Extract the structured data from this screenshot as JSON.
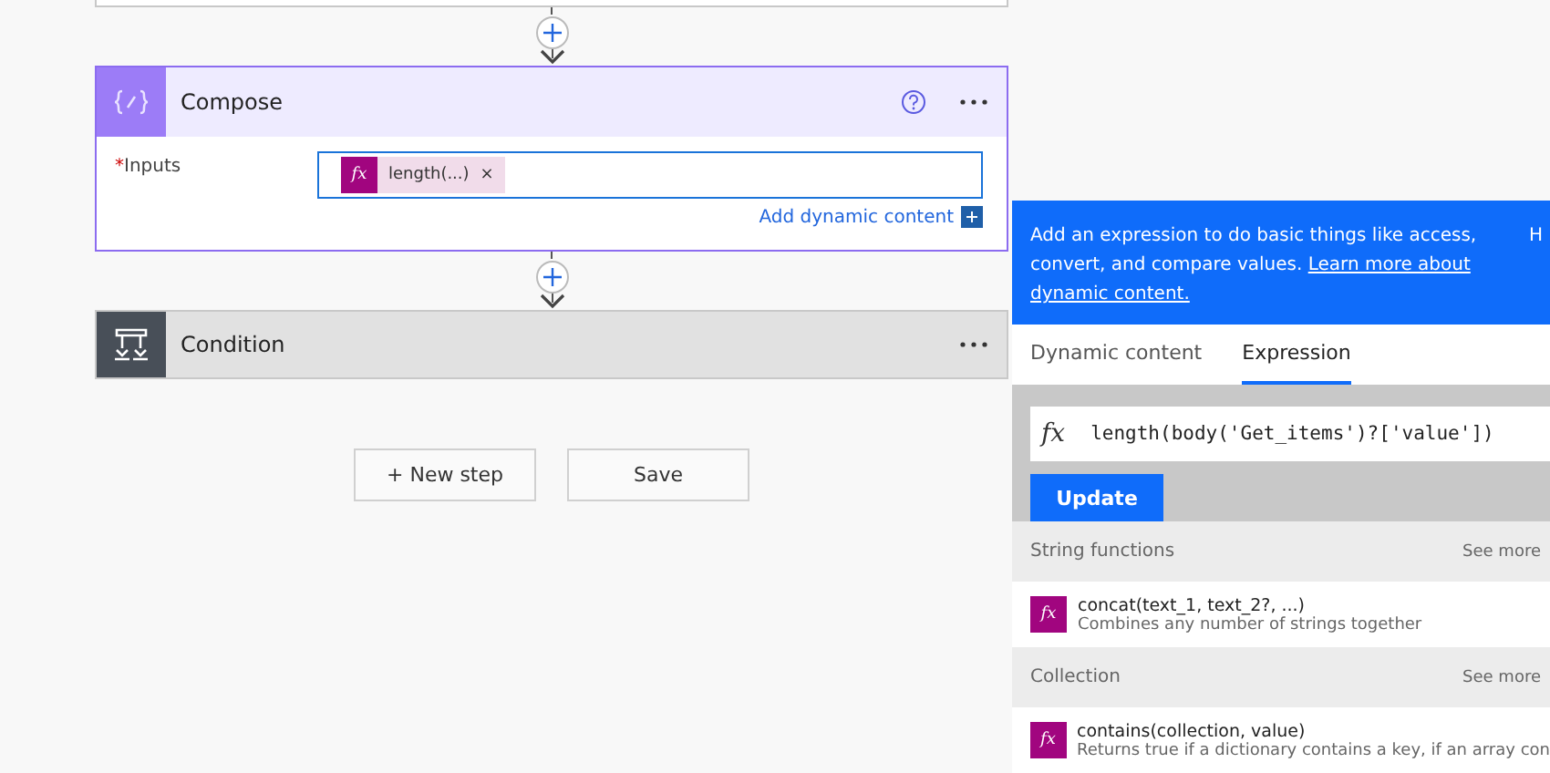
{
  "compose": {
    "title": "Compose",
    "field_label": "Inputs",
    "required_mark": "*",
    "token_icon": "fx",
    "token": "length(...)",
    "token_remove": "×",
    "add_dynamic": "Add dynamic content"
  },
  "condition": {
    "title": "Condition"
  },
  "buttons": [
    {
      "label": "+ New step"
    },
    {
      "label": "Save"
    }
  ],
  "panel": {
    "info": "Add an expression to do basic things like access, convert, and compare values. ",
    "info_link": [
      "Learn more about",
      "dynamic content."
    ],
    "info_cut": "H",
    "tabs": [
      {
        "label": "Dynamic content",
        "selected": false
      },
      {
        "label": "Expression",
        "selected": true
      }
    ],
    "expression_icon": "fx",
    "expression": "length(body('Get_items')?['value'])",
    "update": "Update",
    "groups": [
      {
        "title": "String functions",
        "see_more": "See more",
        "items": [
          {
            "icon": "fx",
            "name": "concat(text_1, text_2?, ...)",
            "description": "Combines any number of strings together"
          }
        ]
      },
      {
        "title": "Collection",
        "see_more": "See more",
        "items": [
          {
            "icon": "fx",
            "name": "contains(collection, value)",
            "description": "Returns true if a dictionary contains a key, if an array con"
          }
        ]
      }
    ]
  }
}
